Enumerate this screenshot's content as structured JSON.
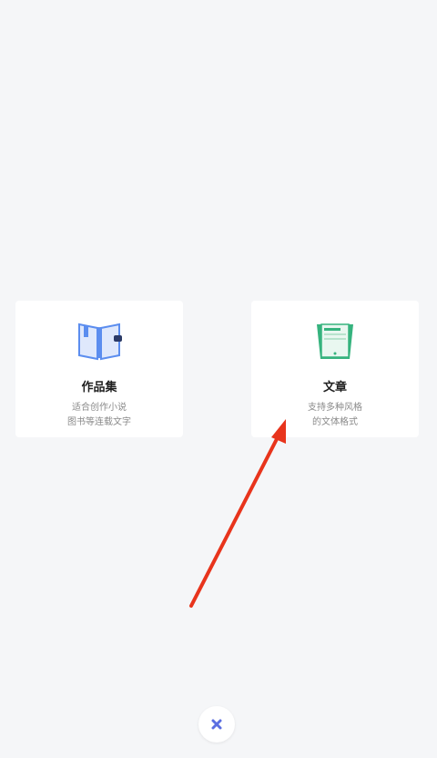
{
  "cards": [
    {
      "title": "作品集",
      "desc_line1": "适合创作小说",
      "desc_line2": "图书等连载文字",
      "icon": "book-icon",
      "accent": "#5b8def"
    },
    {
      "title": "文章",
      "desc_line1": "支持多种风格",
      "desc_line2": "的文体格式",
      "icon": "document-icon",
      "accent": "#36b37e"
    }
  ],
  "close": {
    "icon": "close-icon",
    "color": "#5b6ee1"
  },
  "annotation": {
    "icon": "red-arrow-annotation",
    "color": "#e8341c"
  },
  "colors": {
    "background": "#f5f6f8",
    "card": "#ffffff"
  }
}
